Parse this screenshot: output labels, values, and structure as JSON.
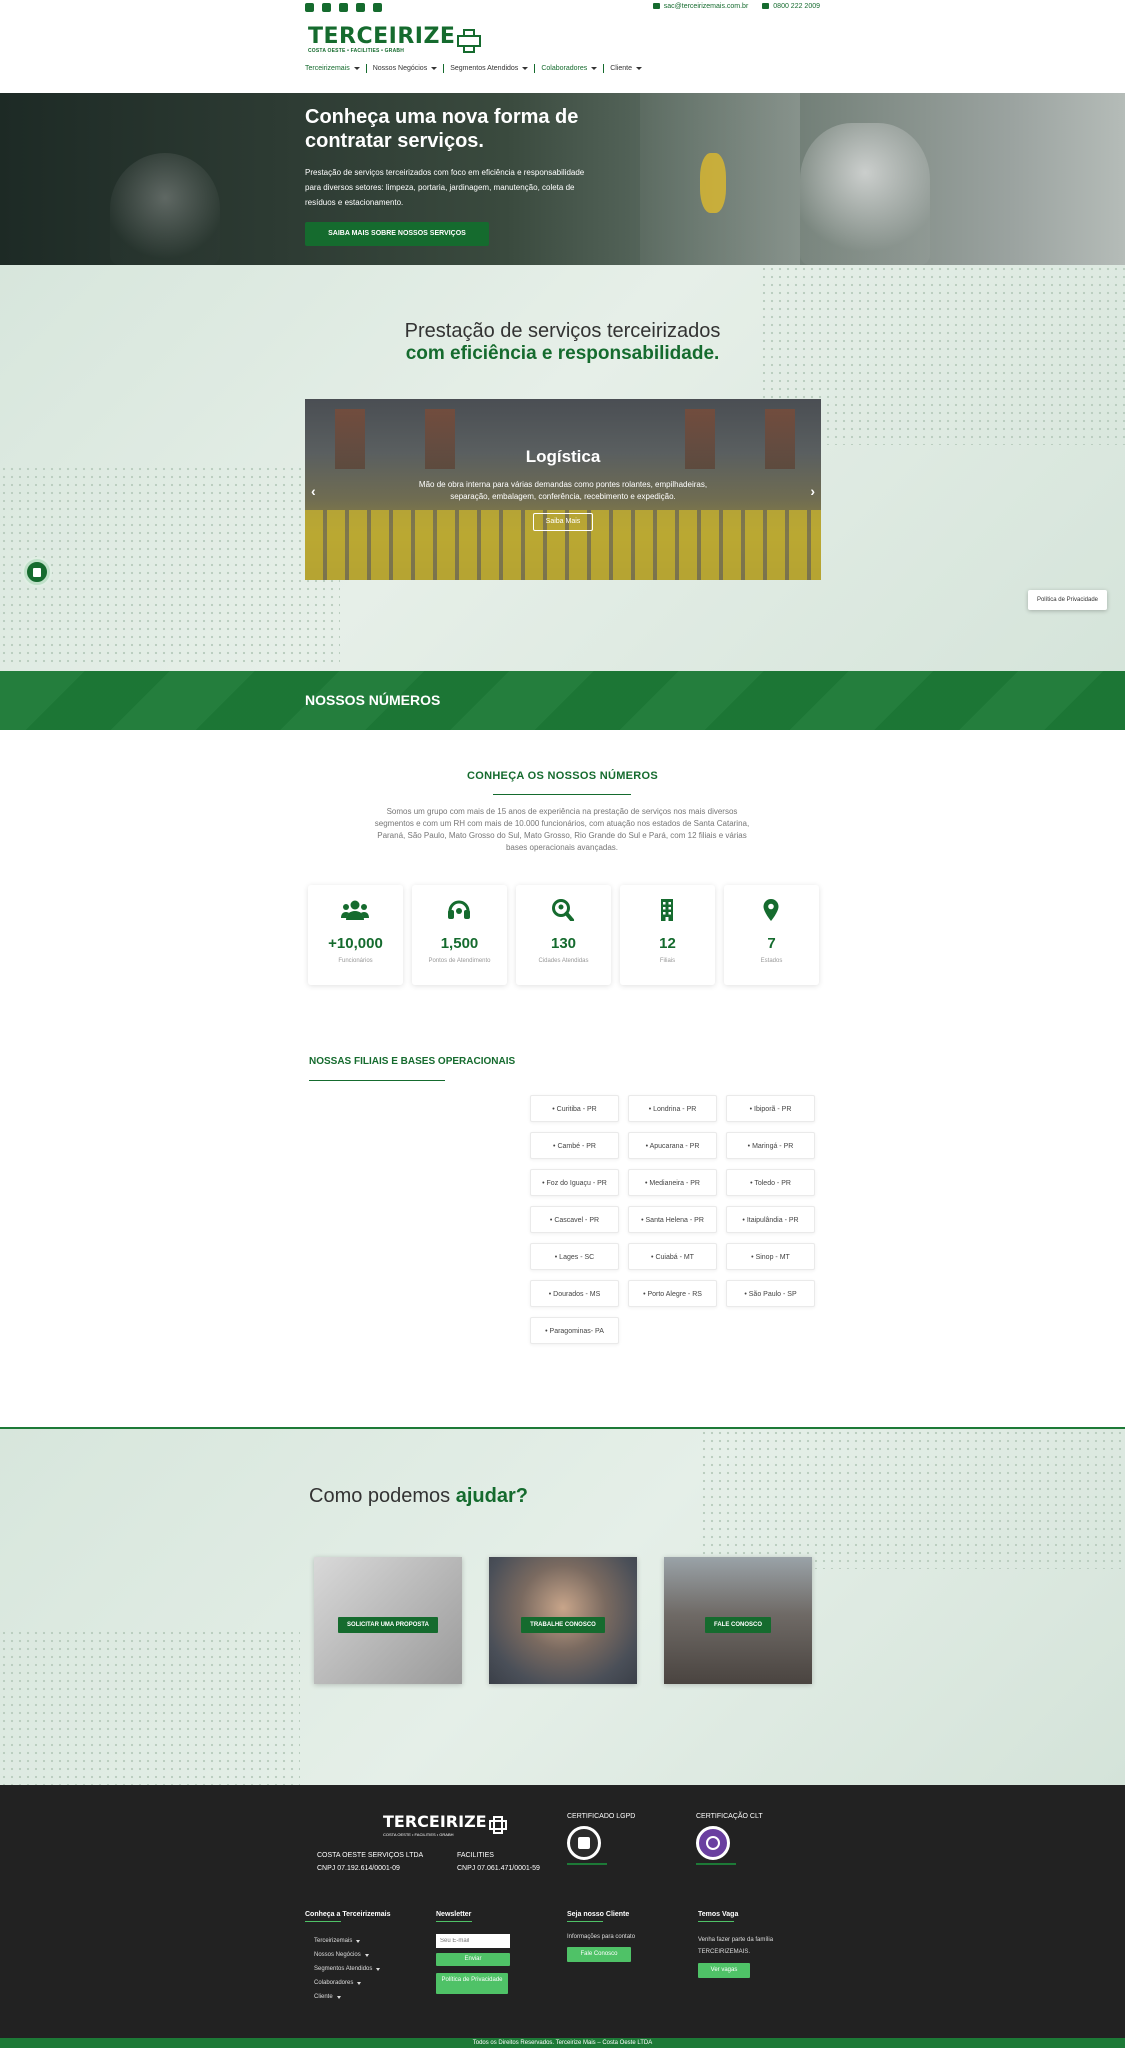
{
  "topbar": {
    "social_icons": [
      "facebook-icon",
      "instagram-icon",
      "linkedin-icon",
      "youtube-icon",
      "whatsapp-icon"
    ],
    "email": "sac@terceirizemais.com.br",
    "phone": "0800 222 2009"
  },
  "logo": {
    "name": "TERCEIRIZE",
    "tagline": "COSTA OESTE • FACILITIES • GRABH"
  },
  "nav": {
    "items": [
      {
        "label": "Terceirizemais"
      },
      {
        "label": "Nossos Negócios"
      },
      {
        "label": "Segmentos Atendidos"
      },
      {
        "label": "Colaboradores"
      },
      {
        "label": "Cliente"
      }
    ]
  },
  "hero": {
    "title": "Conheça uma nova forma de contratar serviços.",
    "text": "Prestação de serviços terceirizados com foco em eficiência e responsabilidade para diversos setores: limpeza, portaria, jardinagem, manutenção, coleta de resíduos e estacionamento.",
    "button": "SAIBA MAIS SOBRE NOSSOS SERVIÇOS"
  },
  "services": {
    "heading": "Prestação de serviços terceirizados",
    "heading_strong": "com eficiência e responsabilidade.",
    "slide": {
      "title": "Logística",
      "description": "Mão de obra interna para várias demandas como pontes rolantes, empilhadeiras, separação, embalagem, conferência, recebimento e expedição.",
      "button": "Saiba Mais"
    }
  },
  "privacy_tab": "Política de Privacidade",
  "numbers_band": {
    "title": "NOSSOS NÚMEROS"
  },
  "numbers": {
    "title": "CONHEÇA OS NOSSOS NÚMEROS",
    "text": "Somos um grupo com mais de 15 anos de experiência na prestação de serviços nos mais diversos segmentos e com um RH com mais de 10.000 funcionários, com atuação nos estados de Santa Catarina, Paraná, São Paulo, Mato Grosso do Sul, Mato Grosso, Rio Grande do Sul e Pará, com 12 filiais e várias bases operacionais avançadas.",
    "stats": [
      {
        "value": "+10,000",
        "label": "Funcionários",
        "icon": "users-icon"
      },
      {
        "value": "1,500",
        "label": "Pontos de Atendimento",
        "icon": "headset-icon"
      },
      {
        "value": "130",
        "label": "Cidades Atendidas",
        "icon": "search-location-icon"
      },
      {
        "value": "12",
        "label": "Filiais",
        "icon": "building-icon"
      },
      {
        "value": "7",
        "label": "Estados",
        "icon": "map-marker-icon"
      }
    ]
  },
  "filiais": {
    "title": "NOSSAS FILIAIS E BASES OPERACIONAIS",
    "cities": [
      "• Curitiba - PR",
      "• Londrina - PR",
      "• Ibiporã - PR",
      "• Cambé - PR",
      "• Apucarana - PR",
      "• Maringá - PR",
      "• Foz do Iguaçu - PR",
      "• Medianeira - PR",
      "• Toledo - PR",
      "• Cascavel - PR",
      "• Santa Helena - PR",
      "• Itaipulândia - PR",
      "• Lages - SC",
      "• Cuiabá - MT",
      "• Sinop - MT",
      "• Dourados - MS",
      "• Porto Alegre - RS",
      "• São Paulo - SP",
      "• Paragominas- PA"
    ]
  },
  "help": {
    "heading": "Como podemos",
    "heading_strong": "ajudar?",
    "cards": [
      {
        "label": "SOLICITAR UMA PROPOSTA"
      },
      {
        "label": "TRABALHE CONOSCO"
      },
      {
        "label": "FALE CONOSCO"
      }
    ]
  },
  "footer": {
    "logo_name": "TERCEIRIZE",
    "logo_tagline": "COSTA OESTE • FACILITIES • GRABH",
    "company1_name": "COSTA OESTE SERVIÇOS LTDA",
    "company1_cnpj": "CNPJ 07.192.614/0001-09",
    "company2_name": "FACILITIES",
    "company2_cnpj": "CNPJ 07.061.471/0001-59",
    "cert1": "CERTIFICADO LGPD",
    "cert2": "CERTIFICAÇÃO CLT",
    "col1_title": "Conheça a Terceirizemais",
    "col1_links": [
      "Terceirizemais",
      "Nossos Negócios",
      "Segmentos Atendidos",
      "Colaboradores",
      "Cliente"
    ],
    "col2_title": "Newsletter",
    "email_placeholder": "Seu E-mail",
    "send_button": "Enviar",
    "privacy_button": "Política de Privacidade",
    "col3_title": "Seja nosso Cliente",
    "col3_text": "Informações para contato",
    "col3_button": "Fale Conosco",
    "col4_title": "Temos Vaga",
    "col4_text": "Venha fazer parte da família TERCEIRIZEMAIS.",
    "col4_button": "Ver vagas",
    "copyright": "Todos os Direitos Reservados. Terceirize Mais – Costa Oeste LTDA"
  }
}
